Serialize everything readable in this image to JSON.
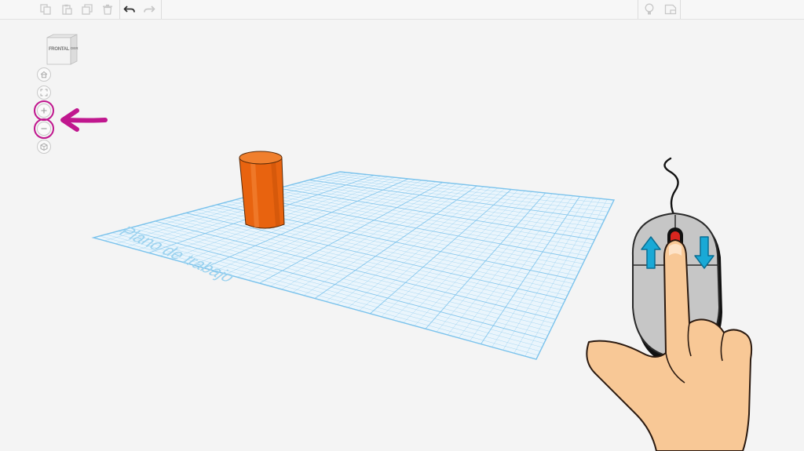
{
  "toolbar": {
    "left_icons": [
      "copy-icon",
      "paste-icon",
      "duplicate-icon",
      "trash-icon",
      "undo-icon",
      "redo-icon"
    ],
    "right_icons": [
      "lightbulb-icon",
      "notes-icon"
    ]
  },
  "view_cube": {
    "front_label": "FRONTAL",
    "side_label": "DER"
  },
  "view_controls": [
    "home-icon",
    "fit-view-icon",
    "zoom-in-icon",
    "zoom-out-icon",
    "orthographic-icon"
  ],
  "workplane": {
    "label": "Plano de trabajo",
    "grid_color": "#7cc3ec"
  },
  "shape": {
    "type": "cylinder",
    "color": "#e8630f"
  },
  "annotation": {
    "arrow_color": "#c0178e",
    "highlighted": [
      "zoom-in-icon",
      "zoom-out-icon"
    ]
  },
  "mouse_illustration": {
    "description_icons": [
      "scroll-up-arrow-icon",
      "scroll-down-arrow-icon"
    ],
    "arrow_color": "#19a9d6"
  }
}
